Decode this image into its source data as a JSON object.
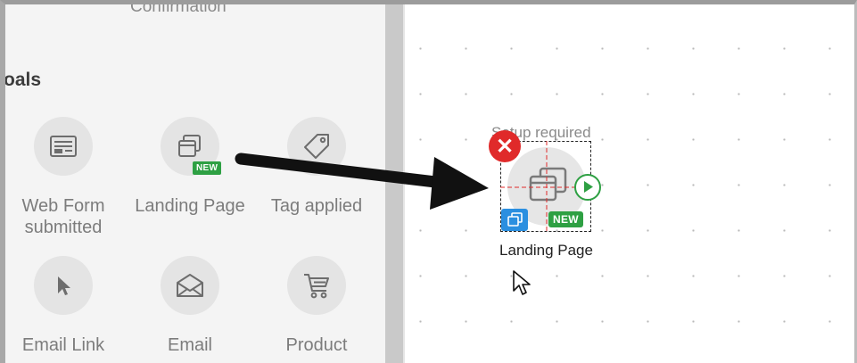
{
  "sidebar": {
    "previous_item_label": "Confirmation",
    "section_title": "oals",
    "items": [
      {
        "label": "Web Form submitted",
        "icon": "web-form-icon",
        "badge": ""
      },
      {
        "label": "Landing Page",
        "icon": "landing-page-icon",
        "badge": "NEW"
      },
      {
        "label": "Tag applied",
        "icon": "tag-icon",
        "badge": ""
      },
      {
        "label": "Email Link",
        "icon": "cursor-pointer-icon",
        "badge": ""
      },
      {
        "label": "Email",
        "icon": "envelope-icon",
        "badge": ""
      },
      {
        "label": "Product",
        "icon": "shopping-cart-icon",
        "badge": ""
      }
    ]
  },
  "canvas": {
    "node": {
      "status": "Setup required",
      "label": "Landing Page",
      "badge": "NEW",
      "icon": "landing-page-icon"
    }
  },
  "colors": {
    "close": "#e02a2a",
    "success": "#2ea043",
    "copy": "#2b8fe0",
    "sidebar_bg": "#f4f4f4"
  }
}
